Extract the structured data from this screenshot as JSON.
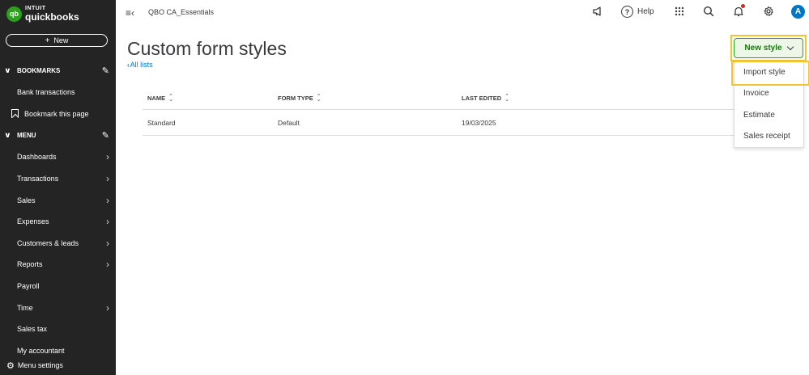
{
  "brand": {
    "badge": "qb",
    "intuit": "INTUIT",
    "name": "quickbooks",
    "color": "#2ca01c"
  },
  "sidebar": {
    "new_label": "New",
    "bookmarks_header": "BOOKMARKS",
    "bookmarks": [
      {
        "label": "Bank transactions"
      },
      {
        "label": "Bookmark this page"
      }
    ],
    "menu_header": "MENU",
    "menu_items": [
      {
        "label": "Dashboards",
        "has_arrow": true
      },
      {
        "label": "Transactions",
        "has_arrow": true
      },
      {
        "label": "Sales",
        "has_arrow": true
      },
      {
        "label": "Expenses",
        "has_arrow": true
      },
      {
        "label": "Customers & leads",
        "has_arrow": true
      },
      {
        "label": "Reports",
        "has_arrow": true
      },
      {
        "label": "Payroll",
        "has_arrow": false
      },
      {
        "label": "Time",
        "has_arrow": true
      },
      {
        "label": "Sales tax",
        "has_arrow": false
      },
      {
        "label": "My accountant",
        "has_arrow": false
      }
    ],
    "menu_settings": "Menu settings",
    "bg_color": "#242424"
  },
  "topbar": {
    "company": "QBO CA_Essentials",
    "help_label": "Help",
    "avatar_initial": "A",
    "icons": [
      "hamburger-collapse-icon",
      "megaphone-icon",
      "help-icon",
      "apps-grid-icon",
      "search-icon",
      "notification-bell-icon",
      "settings-gear-icon"
    ]
  },
  "page": {
    "title": "Custom form styles",
    "back_link": "All lists"
  },
  "table": {
    "columns": [
      "NAME",
      "FORM TYPE",
      "LAST EDITED"
    ],
    "rows": [
      [
        "Standard",
        "Default",
        "19/03/2025"
      ]
    ]
  },
  "new_style": {
    "label": "New style",
    "menu": [
      "Import style",
      "Invoice",
      "Estimate",
      "Sales receipt"
    ],
    "highlight_color": "#f4c430"
  }
}
